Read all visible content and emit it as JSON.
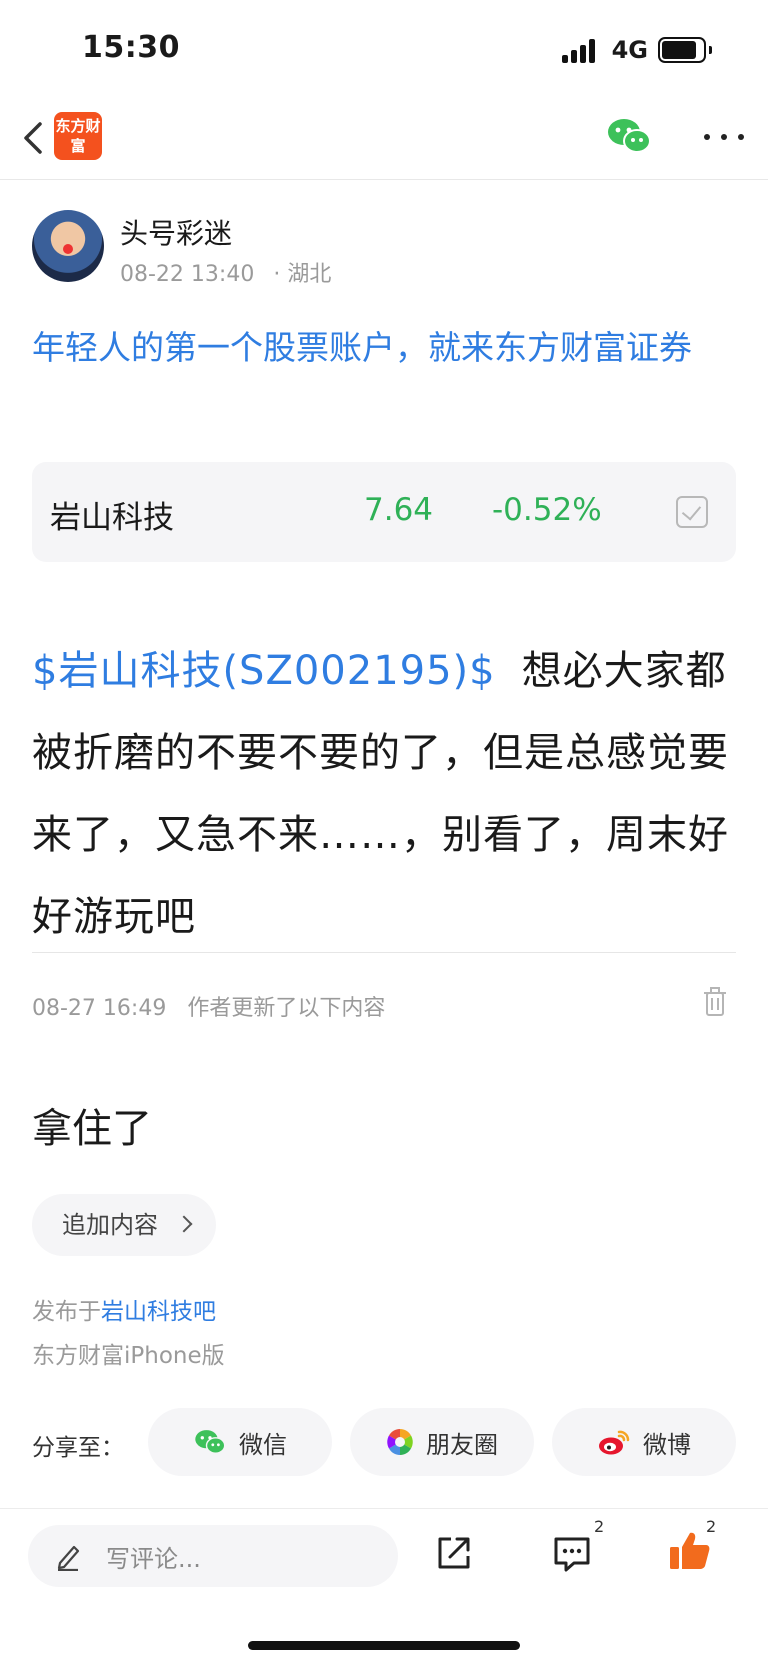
{
  "status_bar": {
    "time": "15:30",
    "network": "4G"
  },
  "nav": {
    "brand_logo_text": "东方财富"
  },
  "author": {
    "name": "头号彩迷",
    "timestamp": "08-22 13:40",
    "location": "· 湖北"
  },
  "ad_link": "年轻人的第一个股票账户，就来东方财富证券",
  "stock": {
    "name": "岩山科技",
    "price": "7.64",
    "change": "-0.52%",
    "change_color": "#2fb157"
  },
  "post": {
    "stock_tag": "$岩山科技(SZ002195)$",
    "text": "想必大家都被折磨的不要不要的了，但是总感觉要来了，又急不来……，别看了，周末好好游玩吧"
  },
  "update": {
    "time": "08-27 16:49",
    "label": "作者更新了以下内容",
    "content": "拿住了"
  },
  "add_content_label": "追加内容",
  "published": {
    "prefix": "发布于",
    "bar_name": "岩山科技吧",
    "client": "东方财富iPhone版"
  },
  "share": {
    "label": "分享至：",
    "wechat": "微信",
    "moments": "朋友圈",
    "weibo": "微博"
  },
  "bottom_bar": {
    "comment_placeholder": "写评论...",
    "comment_count": "2",
    "like_count": "2"
  },
  "colors": {
    "link_blue": "#2f7de1",
    "stock_down_green": "#2fb157",
    "like_orange": "#f26b1d"
  }
}
